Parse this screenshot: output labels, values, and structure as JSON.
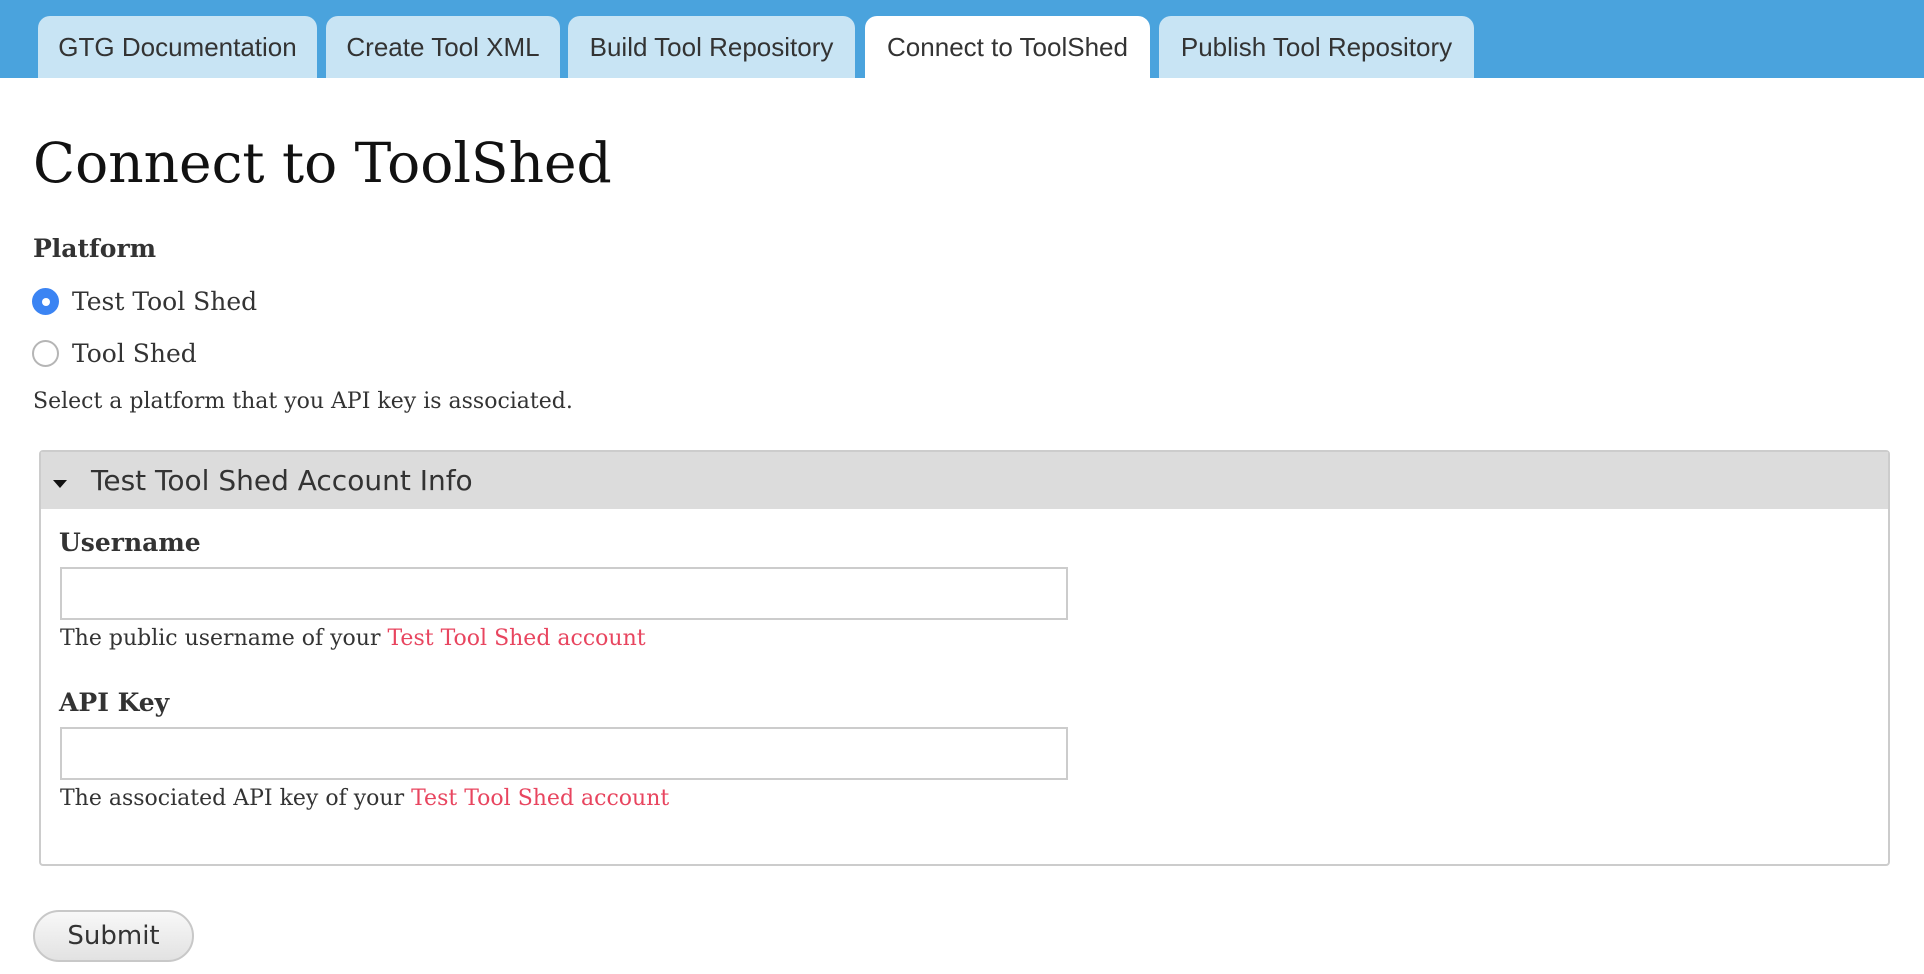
{
  "tabs": [
    {
      "label": "GTG Documentation"
    },
    {
      "label": "Create Tool XML"
    },
    {
      "label": "Build Tool Repository"
    },
    {
      "label": "Connect to ToolShed"
    },
    {
      "label": "Publish Tool Repository"
    }
  ],
  "page": {
    "title": "Connect to ToolShed"
  },
  "platform": {
    "label": "Platform",
    "options": [
      {
        "label": "Test Tool Shed",
        "selected": true
      },
      {
        "label": "Tool Shed",
        "selected": false
      }
    ],
    "help": "Select a platform that you API key is associated."
  },
  "account": {
    "legend": "Test Tool Shed Account Info",
    "username": {
      "label": "Username",
      "value": "",
      "help_prefix": "The public username of your ",
      "help_link": "Test Tool Shed account"
    },
    "api_key": {
      "label": "API Key",
      "value": "",
      "help_prefix": "The associated API key of your ",
      "help_link": "Test Tool Shed account"
    }
  },
  "submit_label": "Submit",
  "colors": {
    "tabbar": "#4aa3dd",
    "tab": "#c8e4f4",
    "radio_selected": "#3b84f3",
    "link": "#e8455f",
    "legend_bg": "#dcdcdc"
  }
}
